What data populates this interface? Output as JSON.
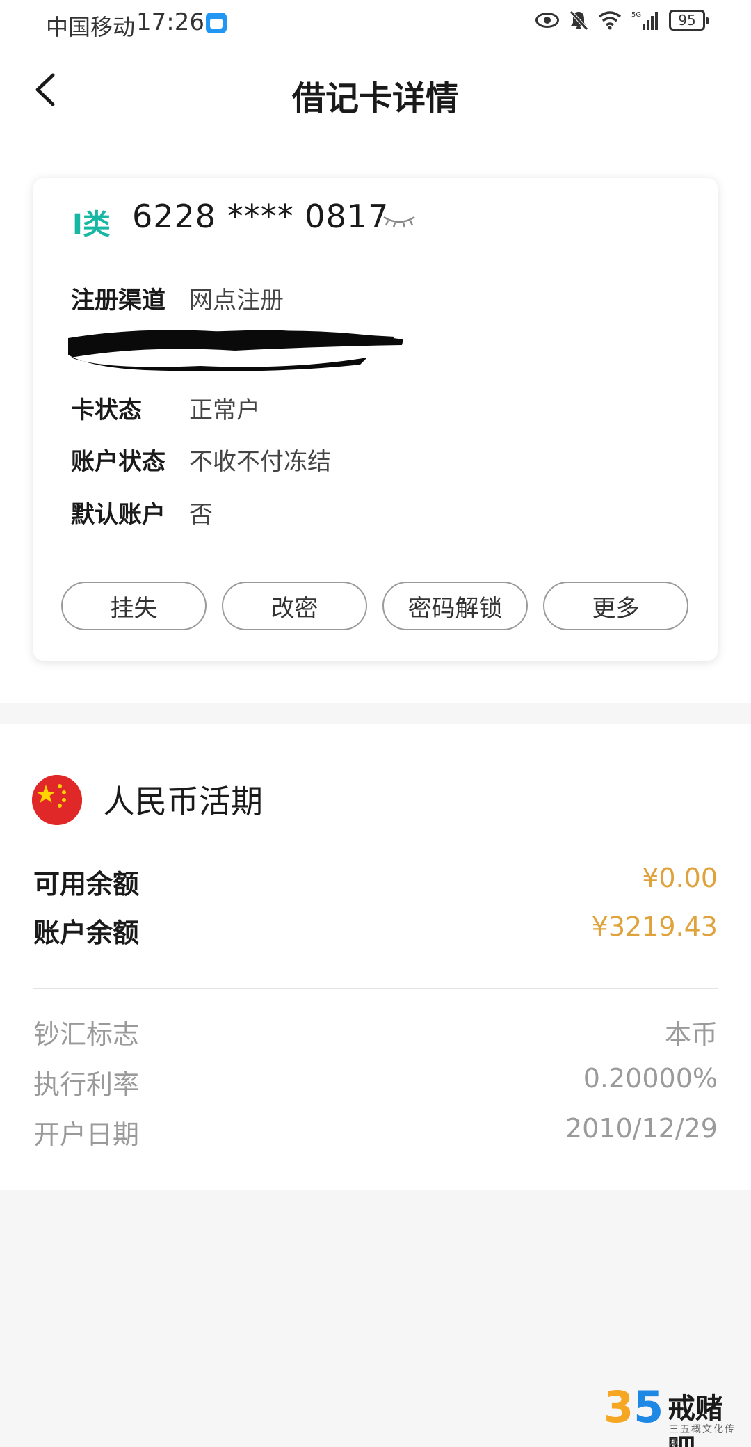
{
  "status_bar": {
    "carrier": "中国移动",
    "time": "17:26",
    "battery": "95",
    "network": "5G"
  },
  "header": {
    "title": "借记卡详情"
  },
  "card": {
    "type": "I类",
    "number": "6228 **** 0817",
    "rows": [
      {
        "label": "注册渠道",
        "value": "网点注册"
      },
      {
        "label": "卡状态",
        "value": "正常户"
      },
      {
        "label": "账户状态",
        "value": "不收不付冻结"
      },
      {
        "label": "默认账户",
        "value": "否"
      }
    ],
    "buttons": [
      "挂失",
      "改密",
      "密码解锁",
      "更多"
    ]
  },
  "account": {
    "title": "人民币活期",
    "available_label": "可用余额",
    "available_value": "¥0.00",
    "balance_label": "账户余额",
    "balance_value": "¥3219.43",
    "details": [
      {
        "label": "钞汇标志",
        "value": "本币"
      },
      {
        "label": "执行利率",
        "value": "0.20000%"
      },
      {
        "label": "开户日期",
        "value": "2010/12/29"
      }
    ]
  },
  "watermark": {
    "number_a": "3",
    "number_b": "5",
    "name": "戒赌吧",
    "subtitle": "三五概文化传承"
  },
  "colors": {
    "accent_teal": "#17b7a3",
    "amount_gold": "#e0a23a",
    "flag_red": "#e02828"
  }
}
